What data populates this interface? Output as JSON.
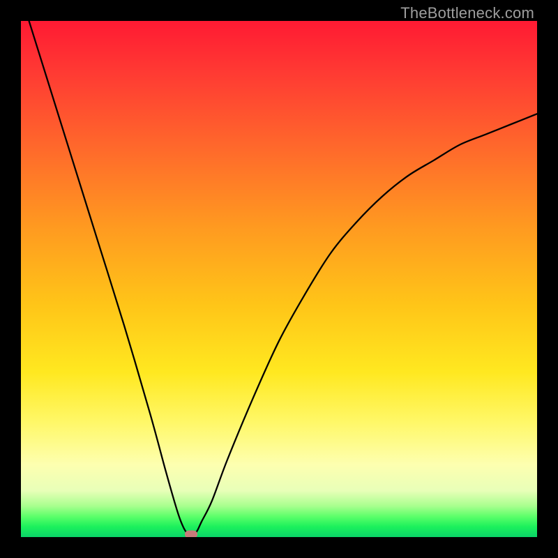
{
  "watermark": "TheBottleneck.com",
  "colors": {
    "page_bg": "#000000",
    "curve": "#000000",
    "marker": "#c77a7a",
    "gradient_top": "#ff1a33",
    "gradient_bottom": "#0ad468"
  },
  "chart_data": {
    "type": "line",
    "title": "",
    "xlabel": "",
    "ylabel": "",
    "xlim": [
      0,
      100
    ],
    "ylim": [
      0,
      100
    ],
    "grid": false,
    "legend": false,
    "background": "vertical-gradient red→green (top→bottom)",
    "series": [
      {
        "name": "bottleneck-curve",
        "x": [
          0,
          5,
          10,
          15,
          20,
          25,
          28,
          30,
          31,
          32,
          33,
          34,
          35,
          37,
          40,
          45,
          50,
          55,
          60,
          65,
          70,
          75,
          80,
          85,
          90,
          95,
          100
        ],
        "values": [
          105,
          89,
          73,
          57,
          41,
          24,
          13,
          6,
          3,
          1,
          0.5,
          1,
          3,
          7,
          15,
          27,
          38,
          47,
          55,
          61,
          66,
          70,
          73,
          76,
          78,
          80,
          82
        ]
      }
    ],
    "annotations": [
      {
        "name": "minimum-marker",
        "x": 33,
        "y": 0.5
      }
    ]
  }
}
